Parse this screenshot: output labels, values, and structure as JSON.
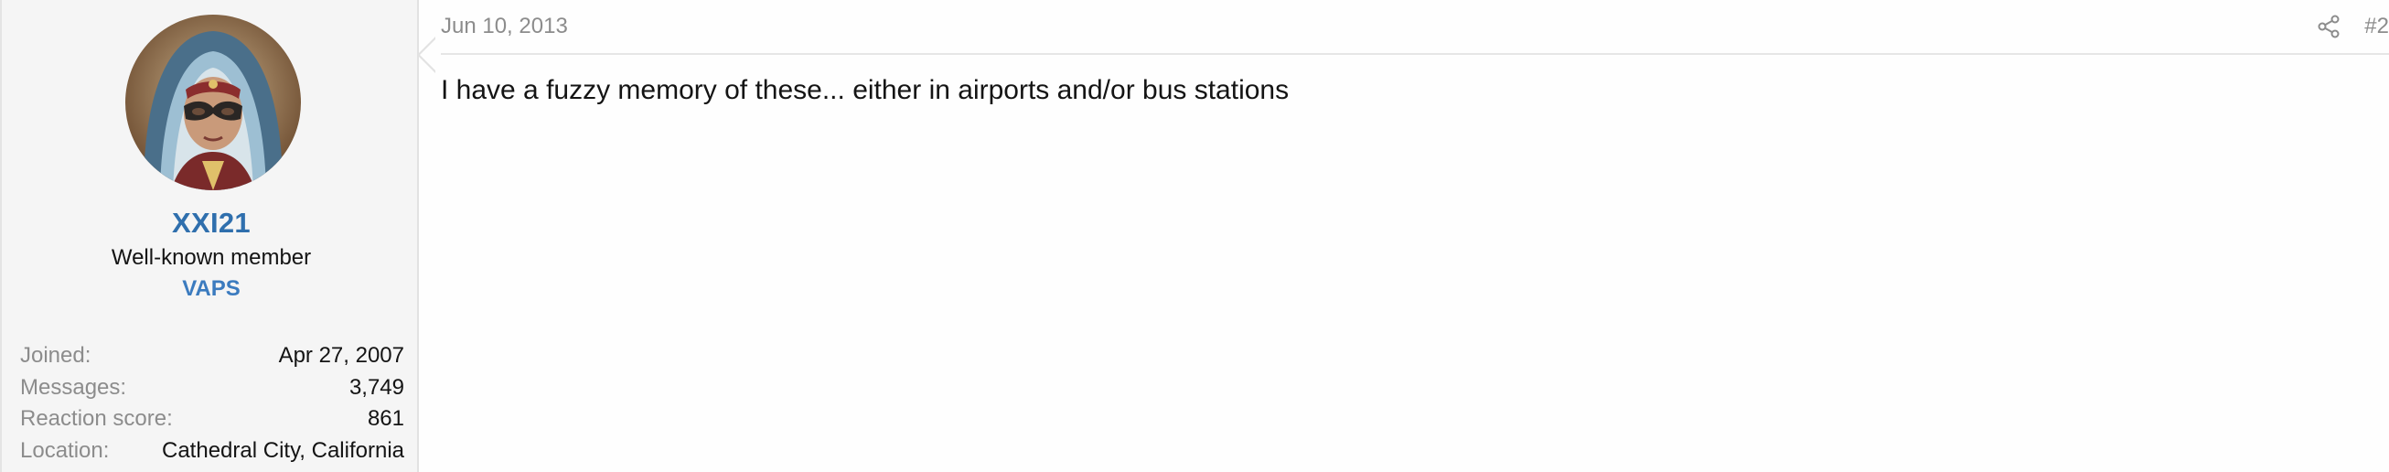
{
  "user": {
    "username": "XXI21",
    "title": "Well-known member",
    "banner": "VAPS",
    "avatar_icon": "avatar-portrait",
    "stats": [
      {
        "label": "Joined:",
        "value": "Apr 27, 2007"
      },
      {
        "label": "Messages:",
        "value": "3,749"
      },
      {
        "label": "Reaction score:",
        "value": "861"
      },
      {
        "label": "Location:",
        "value": "Cathedral City, California"
      }
    ]
  },
  "post": {
    "date": "Jun 10, 2013",
    "number": "#2",
    "share_icon": "share-icon",
    "body": "I have a fuzzy memory of these... either in airports and/or bus stations"
  },
  "colors": {
    "username": "#2f6fad",
    "banner": "#3b7bbf",
    "sidebar_bg": "#f5f5f5",
    "muted_text": "#8c8c8c"
  }
}
